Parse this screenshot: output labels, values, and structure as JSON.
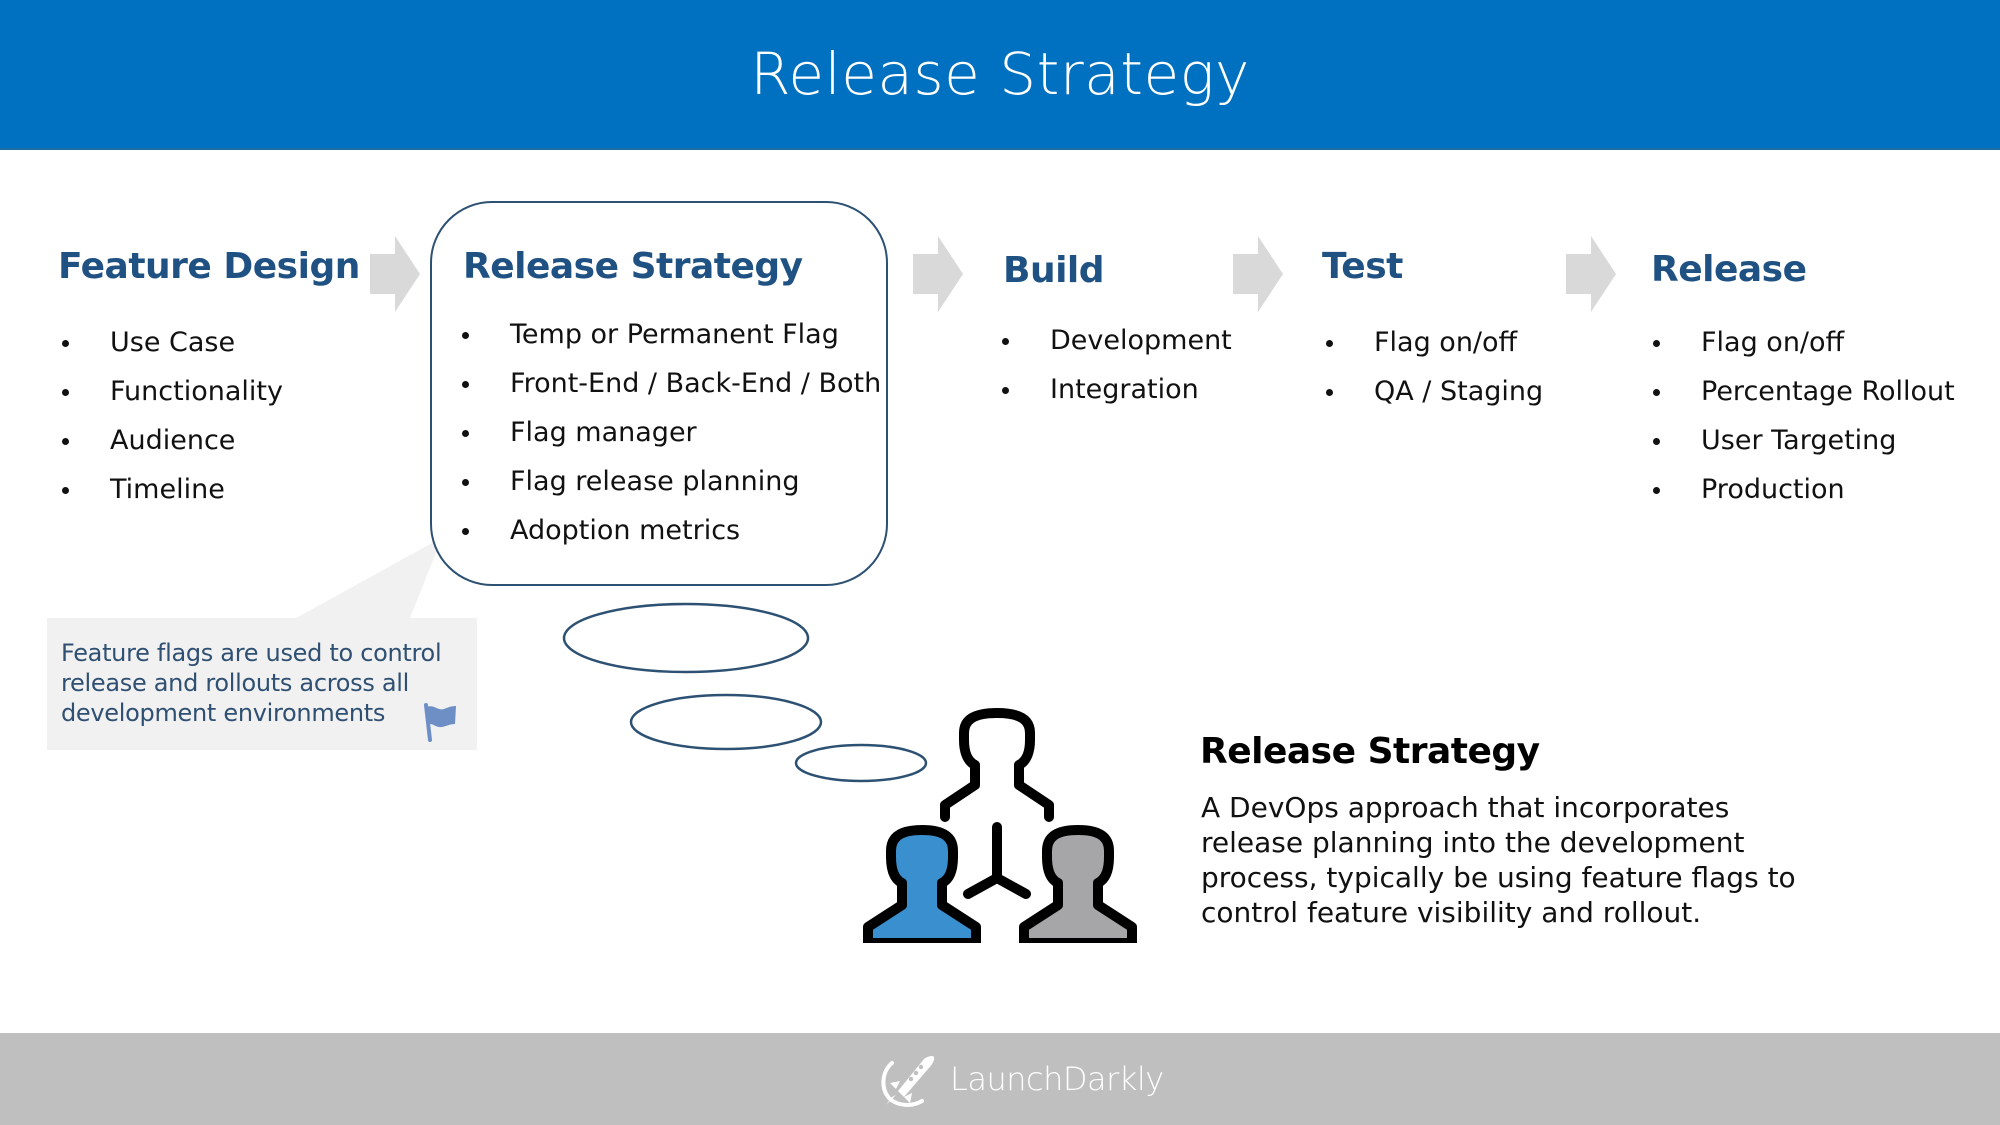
{
  "header": {
    "title": "Release Strategy"
  },
  "stages": [
    {
      "heading": "Feature Design",
      "items": [
        "Use Case",
        "Functionality",
        "Audience",
        "Timeline"
      ]
    },
    {
      "heading": "Release Strategy",
      "items": [
        "Temp or Permanent Flag",
        "Front-End / Back-End / Both",
        "Flag manager",
        "Flag release planning",
        "Adoption metrics"
      ]
    },
    {
      "heading": "Build",
      "items": [
        "Development",
        "Integration"
      ]
    },
    {
      "heading": "Test",
      "items": [
        "Flag on/off",
        "QA / Staging"
      ]
    },
    {
      "heading": "Release",
      "items": [
        "Flag on/off",
        "Percentage Rollout",
        "User Targeting",
        "Production"
      ]
    }
  ],
  "callout": {
    "text": "Feature flags are used to control release and rollouts across all development environments",
    "icon": "flag-icon"
  },
  "description": {
    "title": "Release Strategy",
    "body": "A DevOps approach that incorporates release planning into the development process, typically be using feature flags to control feature visibility and rollout."
  },
  "icons": {
    "arrow": "chevron-arrow-right-icon",
    "people": "team-hierarchy-icon",
    "logo": "rocket-logo-icon"
  },
  "footer": {
    "brand": "LaunchDarkly"
  },
  "colors": {
    "header_bg": "#0070c0",
    "heading": "#1f5182",
    "focus_border": "#2d5173",
    "arrow": "#d9d9d9",
    "callout_bg": "#f1f1f1",
    "callout_text": "#2f5072",
    "flag": "#6e8fc6",
    "person_blue": "#3a8fce",
    "person_gray": "#a6a6a8",
    "footer_bg": "#bfbfbf"
  }
}
